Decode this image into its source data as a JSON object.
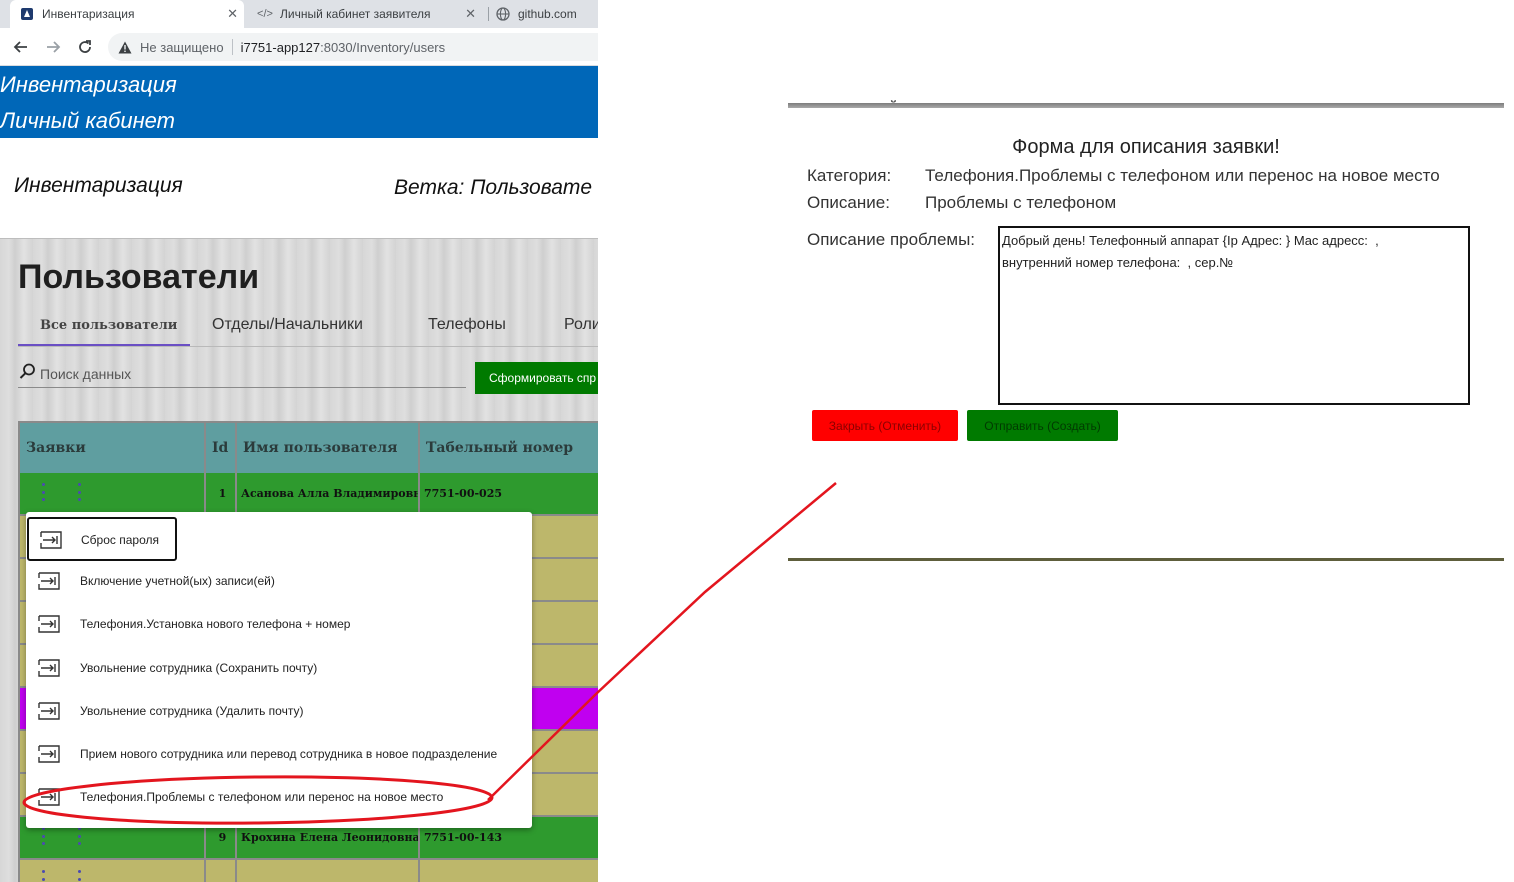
{
  "browser": {
    "tabs": [
      {
        "title": "Инвентаризация",
        "active": true
      },
      {
        "title": "Личный кабинет заявителя",
        "active": false
      },
      {
        "title": "github.com",
        "active": false
      }
    ],
    "security_label": "Не защищено",
    "url_host": "i7751-app127",
    "url_rest": ":8030/Inventory/users"
  },
  "app": {
    "banner_line1": "Инвентаризация",
    "banner_line2": "Личный кабинет",
    "sub_title": "Инвентаризация",
    "branch": "Ветка: Пользовате",
    "page_title": "Пользователи"
  },
  "nav_tabs": [
    {
      "label": "Все пользователи",
      "active": true
    },
    {
      "label": "Отделы/Начальники",
      "active": false
    },
    {
      "label": "Телефоны",
      "active": false
    },
    {
      "label": "Роли",
      "active": false
    }
  ],
  "search": {
    "placeholder": "Поиск данных",
    "value": ""
  },
  "generate_button": "Сформировать спр",
  "table": {
    "headers": [
      "Заявки",
      "Id",
      "Имя пользователя",
      "Табельный номер"
    ],
    "rows": [
      {
        "id": "1",
        "name": "Асанова Алла Владимировна",
        "tab_no": "7751-00-025",
        "color": "#2e9a2e"
      },
      {
        "id": "",
        "name": "",
        "tab_no": "",
        "color": "#bdb76b"
      },
      {
        "id": "",
        "name": "",
        "tab_no": "",
        "color": "#bdb76b"
      },
      {
        "id": "",
        "name": "",
        "tab_no": "",
        "color": "#bdb76b"
      },
      {
        "id": "",
        "name": "",
        "tab_no": "",
        "color": "#bdb76b"
      },
      {
        "id": "",
        "name": "",
        "tab_no": "",
        "color": "#c000f0"
      },
      {
        "id": "",
        "name": "",
        "tab_no": "",
        "color": "#bdb76b"
      },
      {
        "id": "",
        "name": "",
        "tab_no": "",
        "color": "#bdb76b"
      },
      {
        "id": "9",
        "name": "Крохина Елена Леонидовна",
        "tab_no": "7751-00-143",
        "color": "#2e9a2e"
      },
      {
        "id": "",
        "name": "",
        "tab_no": "",
        "color": "#bdb76b"
      }
    ]
  },
  "context_menu": {
    "items": [
      "Сброс пароля",
      "Включение учетной(ых) записи(ей)",
      "Телефония.Установка нового телефона + номер",
      "Увольнение сотрудника (Сохранить почту)",
      "Увольнение сотрудника (Удалить почту)",
      "Прием нового сотрудника или перевод сотрудника в новое подразделение",
      "Телефония.Проблемы с телефоном или перенос на новое место"
    ]
  },
  "form": {
    "top_text": "и пользователей",
    "title": "Форма для описания заявки!",
    "category_label": "Категория:",
    "category_value": "Телефония.Проблемы с телефоном или перенос на новое место",
    "description_label": "Описание:",
    "description_value": "Проблемы с телефоном",
    "problem_label": "Описание проблемы:",
    "problem_text": "Добрый день! Телефонный аппарат {Ip Адрес: } Mac адресс:  ,\nвнутренний номер телефона:  , сер.№",
    "close_button": "Закрыть (Отменить)",
    "send_button": "Отправить (Создать)"
  },
  "colors": {
    "banner": "#0067b8",
    "header_teal": "#5f9ea0",
    "row_green": "#2e9a2e",
    "row_khaki": "#bdb76b",
    "row_purple": "#c000f0",
    "button_green": "#007a00",
    "button_red": "#ff0000",
    "annotation_red": "#e3151e"
  }
}
